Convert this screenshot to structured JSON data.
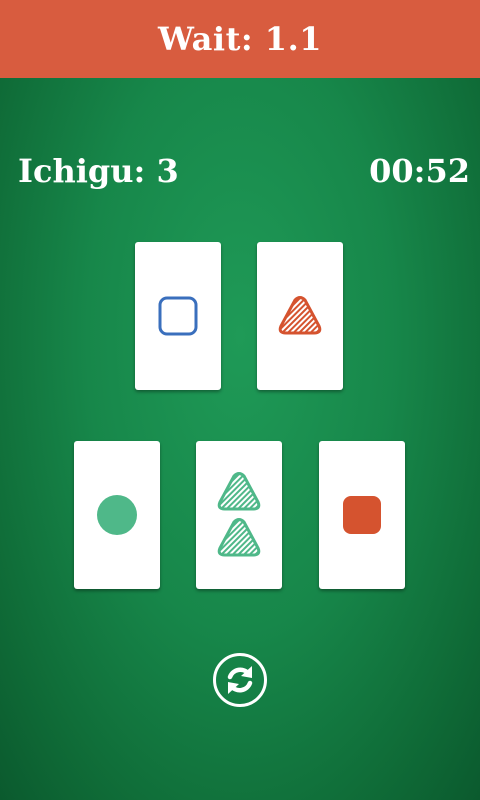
{
  "header": {
    "wait_label": "Wait: 1.1"
  },
  "stats": {
    "score_label": "Ichigu: 3",
    "timer": "00:52"
  },
  "colors": {
    "header_bg": "#d85c3f",
    "felt_green": "#17874a",
    "blue": "#3a6fbd",
    "red": "#d5532f",
    "green": "#4fb889"
  },
  "cards": [
    {
      "shape": "square",
      "color": "blue",
      "fill": "outline",
      "count": 1
    },
    {
      "shape": "triangle",
      "color": "red",
      "fill": "striped",
      "count": 1
    },
    {
      "shape": "circle",
      "color": "green",
      "fill": "solid",
      "count": 1
    },
    {
      "shape": "triangle",
      "color": "green",
      "fill": "striped",
      "count": 2
    },
    {
      "shape": "square",
      "color": "red",
      "fill": "solid",
      "count": 1
    }
  ],
  "controls": {
    "refresh_icon": "refresh-icon"
  }
}
